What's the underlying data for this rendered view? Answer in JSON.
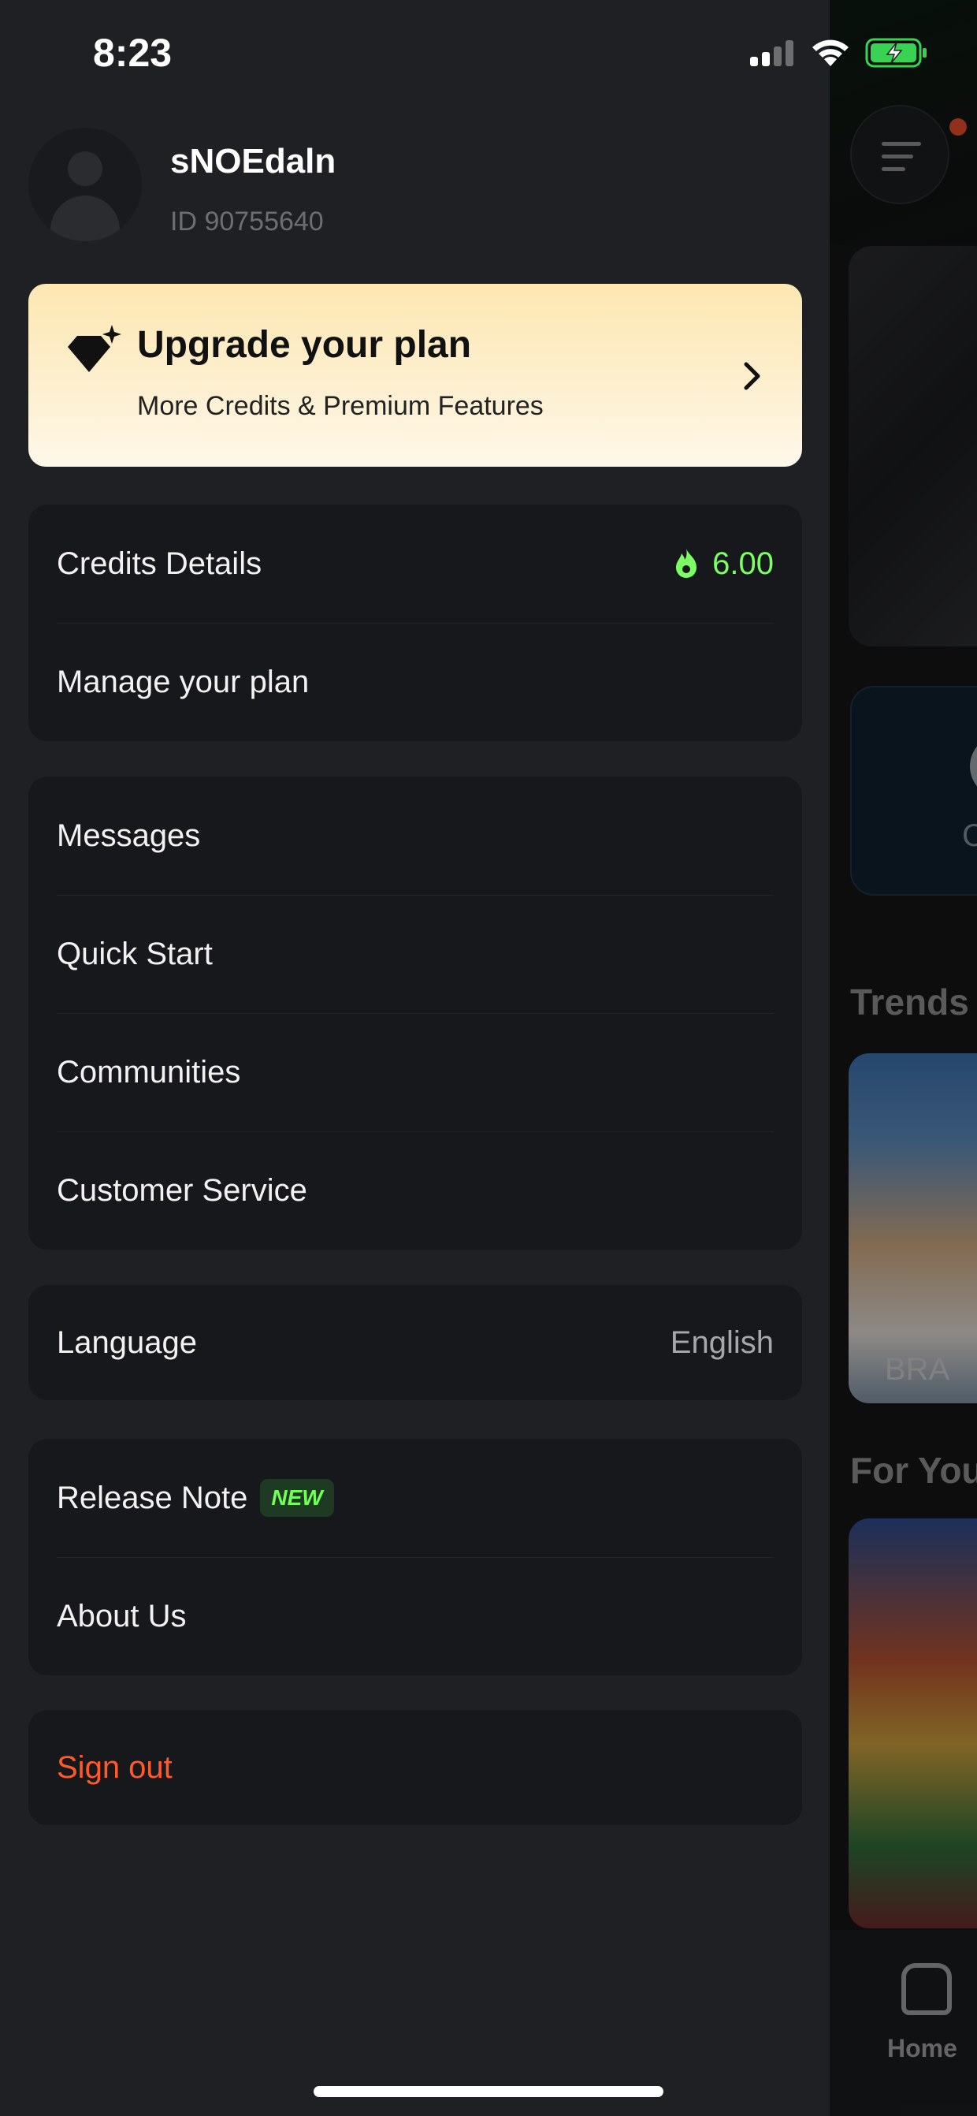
{
  "status_bar": {
    "time": "8:23"
  },
  "profile": {
    "username": "sNOEdaln",
    "user_id": "ID 90755640"
  },
  "upgrade": {
    "title": "Upgrade your plan",
    "subtitle": "More Credits & Premium Features"
  },
  "account_group": {
    "credits_label": "Credits Details",
    "credits_value": "6.00",
    "manage_label": "Manage your plan"
  },
  "menu_group": {
    "items": [
      "Messages",
      "Quick Start",
      "Communities",
      "Customer Service"
    ]
  },
  "language": {
    "label": "Language",
    "value": "English"
  },
  "info_group": {
    "release_label": "Release Note",
    "release_badge": "NEW",
    "about_label": "About Us"
  },
  "signout": {
    "label": "Sign out"
  },
  "background": {
    "trends_heading": "Trends",
    "trend_caption": "BRA",
    "foryou_heading": "For You",
    "card_text": "C",
    "tab_home": "Home"
  },
  "colors": {
    "accent_green": "#7cff62",
    "signout_red": "#ff5a2c",
    "drawer_bg": "#1f2024",
    "group_bg": "#17181b"
  },
  "icons": [
    "diamond-sparkle-icon",
    "chevron-right-icon",
    "flame-icon",
    "home-icon",
    "menu-icon",
    "wifi-icon",
    "battery-charging-icon",
    "signal-icon"
  ]
}
